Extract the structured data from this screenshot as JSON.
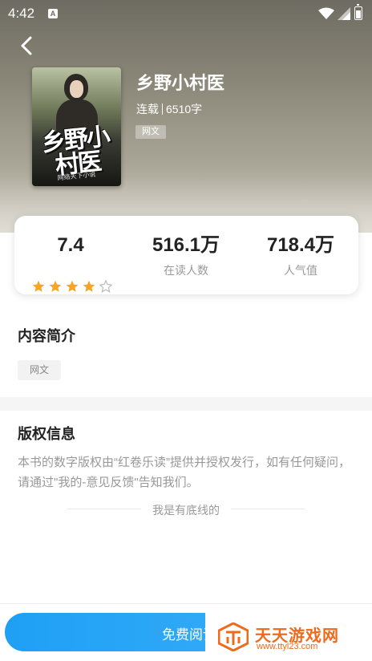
{
  "status_bar": {
    "time": "4:42",
    "notification_icon": "A"
  },
  "book": {
    "title": "乡野小村医",
    "status": "连载",
    "word_count": "6510字",
    "tag": "网文",
    "cover_title": "乡野小村医",
    "cover_subtitle": "网络天下小说"
  },
  "stats": {
    "rating": "7.4",
    "rating_stars": 4,
    "rating_stars_max": 5,
    "readers_value": "516.1万",
    "readers_label": "在读人数",
    "popularity_value": "718.4万",
    "popularity_label": "人气值"
  },
  "intro": {
    "title": "内容简介",
    "tag": "网文"
  },
  "copyright": {
    "title": "版权信息",
    "text": "本书的数字版权由“红卷乐读”提供并授权发行，如有任何疑问，请通过\"我的-意见反馈\"告知我们。",
    "end_text": "我是有底线的"
  },
  "action": {
    "read_label": "免费阅读"
  },
  "watermark": {
    "title": "天天游戏网",
    "url": "www.ttyl23.com"
  },
  "colors": {
    "accent": "#1fa0f5",
    "star": "#f5a623",
    "watermark": "#f06a1c"
  }
}
